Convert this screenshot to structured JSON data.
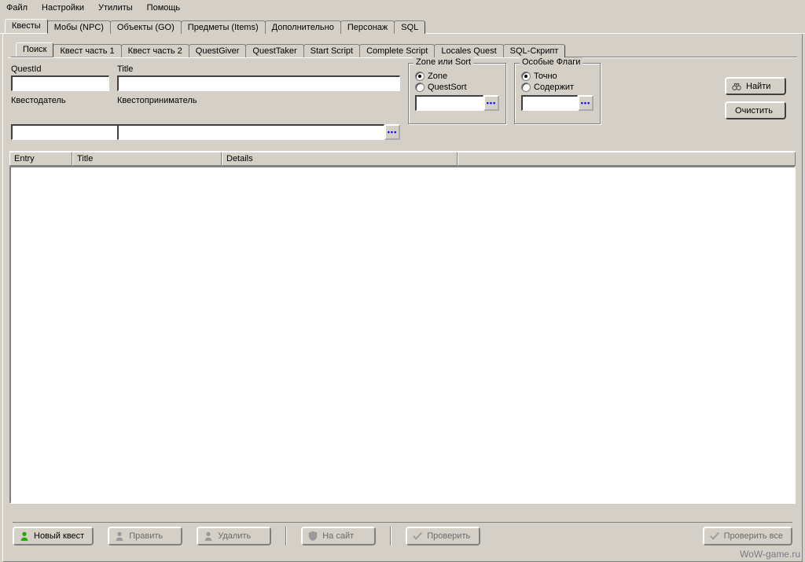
{
  "menu": {
    "file": "Файл",
    "settings": "Настройки",
    "utils": "Утилиты",
    "help": "Помощь"
  },
  "main_tabs": {
    "quests": "Квесты",
    "mobs": "Мобы (NPC)",
    "objects": "Объекты (GO)",
    "items": "Предметы (Items)",
    "additional": "Дополнительно",
    "character": "Персонаж",
    "sql": "SQL"
  },
  "sub_tabs": {
    "search": "Поиск",
    "part1": "Квест часть 1",
    "part2": "Квест часть 2",
    "giver": "QuestGiver",
    "taker": "QuestTaker",
    "start": "Start Script",
    "complete": "Complete Script",
    "locales": "Locales Quest",
    "sql": "SQL-Скрипт"
  },
  "form": {
    "questid_label": "QuestId",
    "title_label": "Title",
    "questgiver_label": "Квестодатель",
    "questtaker_label": "Квестоприниматель",
    "questid_value": "",
    "title_value": "",
    "questgiver_value": "",
    "questtaker_value": ""
  },
  "group_zone": {
    "legend": "Zone или Sort",
    "opt_zone": "Zone",
    "opt_questsort": "QuestSort",
    "selected": "zone",
    "picker_value": ""
  },
  "group_flags": {
    "legend": "Особые Флаги",
    "opt_exact": "Точно",
    "opt_contains": "Содержит",
    "selected": "exact",
    "picker_value": ""
  },
  "buttons": {
    "find": "Найти",
    "clear": "Очистить"
  },
  "grid": {
    "col_entry": "Entry",
    "col_title": "Title",
    "col_details": "Details"
  },
  "bottom": {
    "new": "Новый квест",
    "edit": "Править",
    "delete": "Удалить",
    "tosite": "На сайт",
    "check": "Проверить",
    "checkall": "Проверить все"
  },
  "watermark": "WoW-game.ru"
}
